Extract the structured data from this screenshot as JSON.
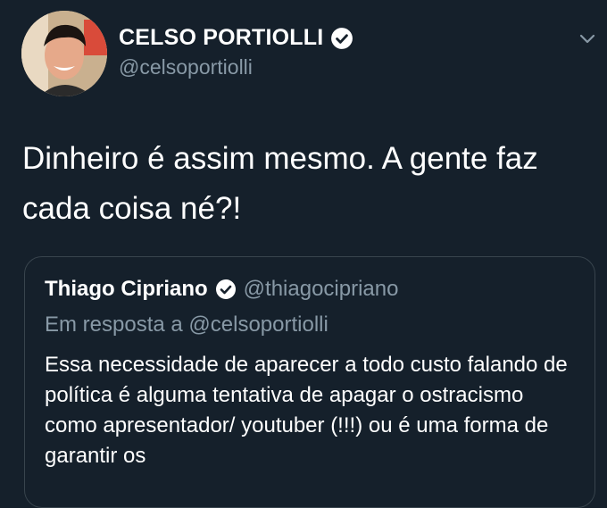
{
  "tweet": {
    "author_name": "CELSO PORTIOLLI",
    "author_handle": "@celsoportiolli",
    "text": "Dinheiro é assim mesmo. A gente faz cada coisa né?!"
  },
  "quoted_tweet": {
    "author_name": "Thiago Cipriano",
    "author_handle": "@thiagocipriano",
    "reply_context": "Em resposta a @celsoportiolli",
    "text": "Essa necessidade de aparecer a todo custo falando de política é alguma tentativa de apagar o ostracismo como apresentador/ youtuber (!!!) ou é uma forma de garantir os"
  },
  "icons": {
    "verified": "verified-badge-icon",
    "menu": "chevron-down-icon"
  },
  "colors": {
    "background": "#15202b",
    "secondary_text": "#8899a6",
    "border": "#38444d"
  }
}
